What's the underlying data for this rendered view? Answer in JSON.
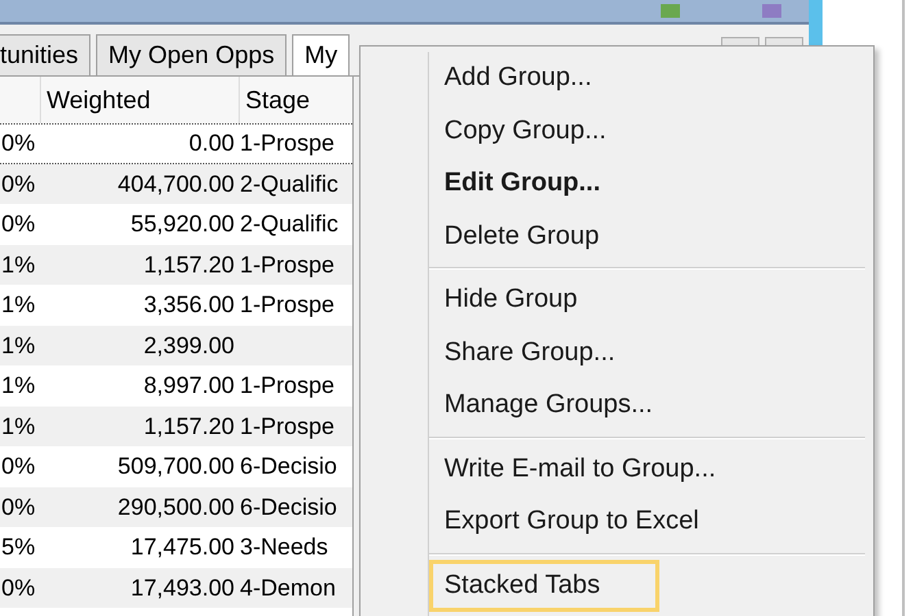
{
  "tabs": [
    {
      "label": "tunities",
      "selected": false
    },
    {
      "label": "My Open Opps",
      "selected": false
    },
    {
      "label": "My",
      "selected": true
    }
  ],
  "table": {
    "columns": [
      "Weighted",
      "Stage"
    ],
    "rows": [
      {
        "percent": "0%",
        "weighted": "0.00",
        "stage": "1-Prospe",
        "focused": true
      },
      {
        "percent": "0%",
        "weighted": "404,700.00",
        "stage": "2-Qualific",
        "focused": false
      },
      {
        "percent": "0%",
        "weighted": "55,920.00",
        "stage": "2-Qualific",
        "focused": false
      },
      {
        "percent": "1%",
        "weighted": "1,157.20",
        "stage": "1-Prospe",
        "focused": false
      },
      {
        "percent": "1%",
        "weighted": "3,356.00",
        "stage": "1-Prospe",
        "focused": false
      },
      {
        "percent": "1%",
        "weighted": "2,399.00",
        "focused": false
      },
      {
        "percent": "1%",
        "weighted": "8,997.00",
        "stage": "1-Prospe",
        "focused": false
      },
      {
        "percent": "1%",
        "weighted": "1,157.20",
        "stage": "1-Prospe",
        "focused": false
      },
      {
        "percent": "0%",
        "weighted": "509,700.00",
        "stage": "6-Decisio",
        "focused": false
      },
      {
        "percent": "0%",
        "weighted": "290,500.00",
        "stage": "6-Decisio",
        "focused": false
      },
      {
        "percent": "5%",
        "weighted": "17,475.00",
        "stage": "3-Needs",
        "focused": false
      },
      {
        "percent": "0%",
        "weighted": "17,493.00",
        "stage": "4-Demon",
        "focused": false
      }
    ]
  },
  "context_menu": {
    "items": [
      {
        "kind": "item",
        "label": "Add Group...",
        "default": false,
        "highlighted": false
      },
      {
        "kind": "item",
        "label": "Copy Group...",
        "default": false,
        "highlighted": false
      },
      {
        "kind": "item",
        "label": "Edit Group...",
        "default": true,
        "highlighted": false
      },
      {
        "kind": "item",
        "label": "Delete Group",
        "default": false,
        "highlighted": false
      },
      {
        "kind": "separator"
      },
      {
        "kind": "item",
        "label": "Hide Group",
        "default": false,
        "highlighted": false
      },
      {
        "kind": "item",
        "label": "Share Group...",
        "default": false,
        "highlighted": false
      },
      {
        "kind": "item",
        "label": "Manage Groups...",
        "default": false,
        "highlighted": false
      },
      {
        "kind": "separator"
      },
      {
        "kind": "item",
        "label": "Write E-mail to Group...",
        "default": false,
        "highlighted": false
      },
      {
        "kind": "item",
        "label": "Export Group to Excel",
        "default": false,
        "highlighted": false
      },
      {
        "kind": "separator"
      },
      {
        "kind": "item",
        "label": "Stacked Tabs",
        "default": false,
        "highlighted": true
      }
    ]
  }
}
